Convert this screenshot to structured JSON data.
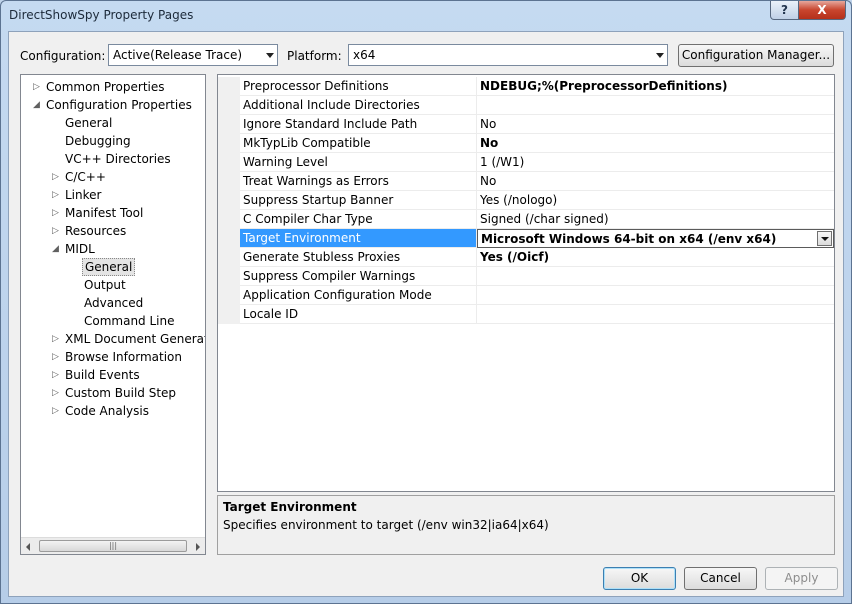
{
  "window": {
    "title": "DirectShowSpy Property Pages",
    "help_glyph": "?",
    "close_glyph": "X"
  },
  "toolbar": {
    "configuration_label": "Configuration:",
    "configuration_value": "Active(Release Trace)",
    "platform_label": "Platform:",
    "platform_value": "x64",
    "config_manager_label": "Configuration Manager..."
  },
  "tree": {
    "items": [
      {
        "label": "Common Properties",
        "level": 0,
        "expander": "▷"
      },
      {
        "label": "Configuration Properties",
        "level": 0,
        "expander": "◢"
      },
      {
        "label": "General",
        "level": 1,
        "expander": ""
      },
      {
        "label": "Debugging",
        "level": 1,
        "expander": ""
      },
      {
        "label": "VC++ Directories",
        "level": 1,
        "expander": ""
      },
      {
        "label": "C/C++",
        "level": 1,
        "expander": "▷"
      },
      {
        "label": "Linker",
        "level": 1,
        "expander": "▷"
      },
      {
        "label": "Manifest Tool",
        "level": 1,
        "expander": "▷"
      },
      {
        "label": "Resources",
        "level": 1,
        "expander": "▷"
      },
      {
        "label": "MIDL",
        "level": 1,
        "expander": "◢"
      },
      {
        "label": "General",
        "level": 2,
        "expander": "",
        "selected": true
      },
      {
        "label": "Output",
        "level": 2,
        "expander": ""
      },
      {
        "label": "Advanced",
        "level": 2,
        "expander": ""
      },
      {
        "label": "Command Line",
        "level": 2,
        "expander": ""
      },
      {
        "label": "XML Document Generator",
        "level": 1,
        "expander": "▷"
      },
      {
        "label": "Browse Information",
        "level": 1,
        "expander": "▷"
      },
      {
        "label": "Build Events",
        "level": 1,
        "expander": "▷"
      },
      {
        "label": "Custom Build Step",
        "level": 1,
        "expander": "▷"
      },
      {
        "label": "Code Analysis",
        "level": 1,
        "expander": "▷"
      }
    ],
    "scroll_thumb_grip": "|||"
  },
  "properties": {
    "rows": [
      {
        "name": "Preprocessor Definitions",
        "value": "NDEBUG;%(PreprocessorDefinitions)",
        "bold": true
      },
      {
        "name": "Additional Include Directories",
        "value": "",
        "bold": false
      },
      {
        "name": "Ignore Standard Include Path",
        "value": "No",
        "bold": false
      },
      {
        "name": "MkTypLib Compatible",
        "value": "No",
        "bold": true
      },
      {
        "name": "Warning Level",
        "value": "1 (/W1)",
        "bold": false
      },
      {
        "name": "Treat Warnings as Errors",
        "value": "No",
        "bold": false
      },
      {
        "name": "Suppress Startup Banner",
        "value": "Yes (/nologo)",
        "bold": false
      },
      {
        "name": "C Compiler Char Type",
        "value": "Signed (/char signed)",
        "bold": false
      },
      {
        "name": "Target Environment",
        "value": "Microsoft Windows 64-bit on x64 (/env x64)",
        "bold": true,
        "selected": true
      },
      {
        "name": "Generate Stubless Proxies",
        "value": "Yes (/Oicf)",
        "bold": true
      },
      {
        "name": "Suppress Compiler Warnings",
        "value": "",
        "bold": false
      },
      {
        "name": "Application Configuration Mode",
        "value": "",
        "bold": false
      },
      {
        "name": "Locale ID",
        "value": "",
        "bold": false
      }
    ]
  },
  "description": {
    "title": "Target Environment",
    "text": "Specifies environment to target (/env win32|ia64|x64)"
  },
  "buttons": {
    "ok": "OK",
    "cancel": "Cancel",
    "apply": "Apply"
  },
  "colors": {
    "selection": "#3399ff",
    "frame": "#b9d1ea"
  }
}
